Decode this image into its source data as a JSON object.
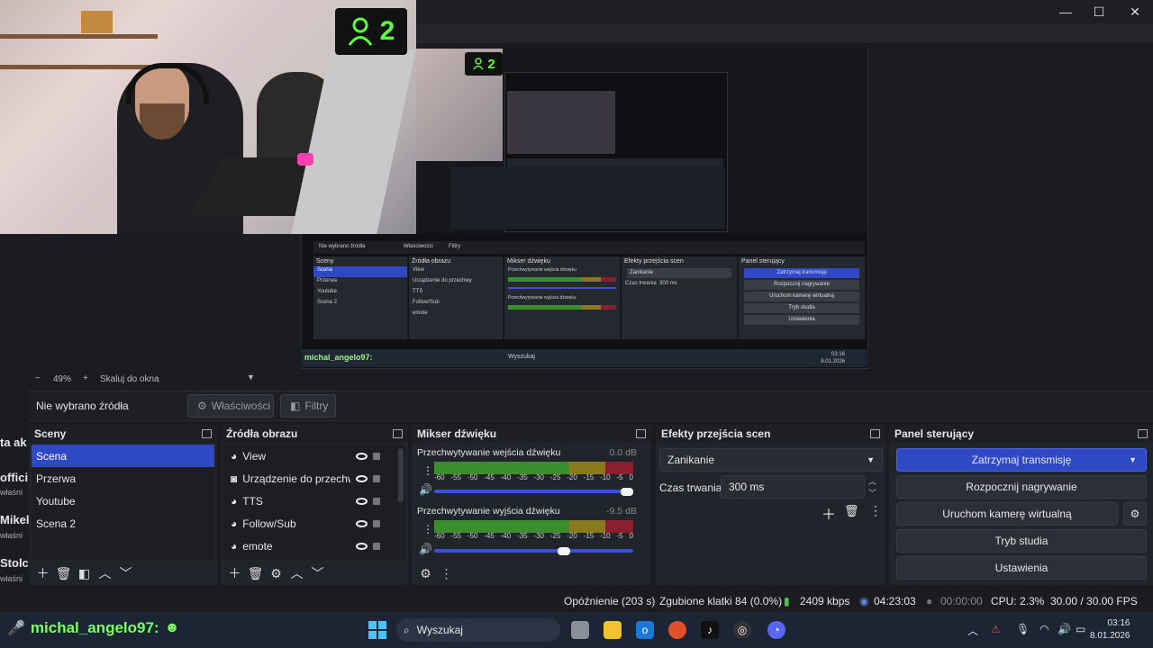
{
  "window": {
    "minimize_glyph": "—",
    "maximize_glyph": "☐",
    "close_glyph": "✕"
  },
  "overlay": {
    "viewer_count": "2",
    "mini_viewer_count": "2"
  },
  "chat_fragments": [
    "ta ak",
    "offici",
    "właśni",
    "Mikel",
    "właśni",
    "Stolc",
    "właśni"
  ],
  "zoom": {
    "minus": "−",
    "percent": "49%",
    "plus": "+",
    "scale_mode": "Skaluj do okna"
  },
  "source_bar": {
    "no_source": "Nie wybrano źródła",
    "properties": "Właściwości",
    "filters": "Filtry"
  },
  "scenes": {
    "title": "Sceny",
    "items": [
      "Scena",
      "Przerwa",
      "Youtube",
      "Scena 2"
    ],
    "selected": "Scena"
  },
  "sources": {
    "title": "Źródła obrazu",
    "items": [
      "View",
      "Urządzenie do przechwy",
      "TTS",
      "Follow/Sub",
      "emote"
    ]
  },
  "mixer": {
    "title": "Mikser dźwięku",
    "tracks": [
      {
        "name": "Przechwytywanie wejścia dźwięku",
        "db": "0.0 dB",
        "level": 0.98
      },
      {
        "name": "Przechwytywanie wyjścia dźwięku",
        "db": "-9.5 dB",
        "level": 0.65
      }
    ],
    "ticks": [
      "-60",
      "-55",
      "-50",
      "-45",
      "-40",
      "-35",
      "-30",
      "-25",
      "-20",
      "-15",
      "-10",
      "-5",
      "0"
    ]
  },
  "transitions": {
    "title": "Efekty przejścia scen",
    "selected": "Zanikanie",
    "duration_label": "Czas trwania",
    "duration_value": "300 ms"
  },
  "controls": {
    "title": "Panel sterujący",
    "stop_stream": "Zatrzymaj transmisję",
    "start_recording": "Rozpocznij nagrywanie",
    "virtual_camera": "Uruchom kamerę wirtualną",
    "studio_mode": "Tryb studia",
    "settings": "Ustawienia"
  },
  "status": {
    "delay": "Opóźnienie (203 s)",
    "dropped": "Zgubione klatki 84 (0.0%)",
    "bitrate": "2409 kbps",
    "stream_time": "04:23:03",
    "record_time": "00:00:00",
    "cpu": "CPU: 2.3%",
    "fps": "30.00 / 30.00 FPS"
  },
  "taskbar": {
    "user_tag": "michal_angelo97:",
    "search_placeholder": "Wyszukaj",
    "time": "03:16",
    "date": "8.01.2026"
  },
  "mini": {
    "no_source": "Nie wybrano źródła",
    "properties": "Właściwości",
    "filters": "Filtry",
    "scenes_title": "Sceny",
    "sources_title": "Źródła obrazu",
    "mixer_title": "Mikser dźwięku",
    "transitions_title": "Efekty przejścia scen",
    "controls_title": "Panel sterujący",
    "user_tag": "michal_angelo97:",
    "search": "Wyszukaj",
    "time": "03:16",
    "date": "8.01.2026"
  },
  "colors": {
    "accent": "#2f49c5",
    "meter_green": "#3b8e2d",
    "meter_yellow": "#8a7a1e",
    "meter_red": "#8a1f2f",
    "viewer_green": "#5dfc3c"
  }
}
